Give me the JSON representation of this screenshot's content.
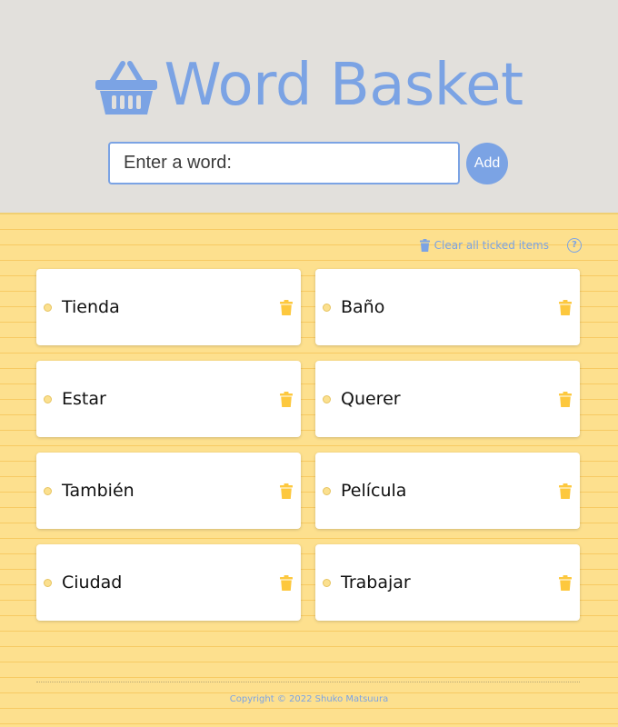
{
  "app": {
    "title": "Word Basket",
    "icon": "basket-icon",
    "accent_color": "#7ba3e4",
    "notebook_color": "#fde08e",
    "header_color": "#e2e0dc"
  },
  "entry": {
    "placeholder": "Enter a word:",
    "value": "",
    "add_label": "Add"
  },
  "toolbar": {
    "clear_label": "Clear all ticked items",
    "clear_icon": "trash-icon",
    "help_icon": "help-icon",
    "help_glyph": "?"
  },
  "words": [
    "Tienda",
    "Baño",
    "Estar",
    "Querer",
    "También",
    "Película",
    "Ciudad",
    "Trabajar"
  ],
  "footer": {
    "copyright": "Copyright © 2022 Shuko Matsuura"
  }
}
